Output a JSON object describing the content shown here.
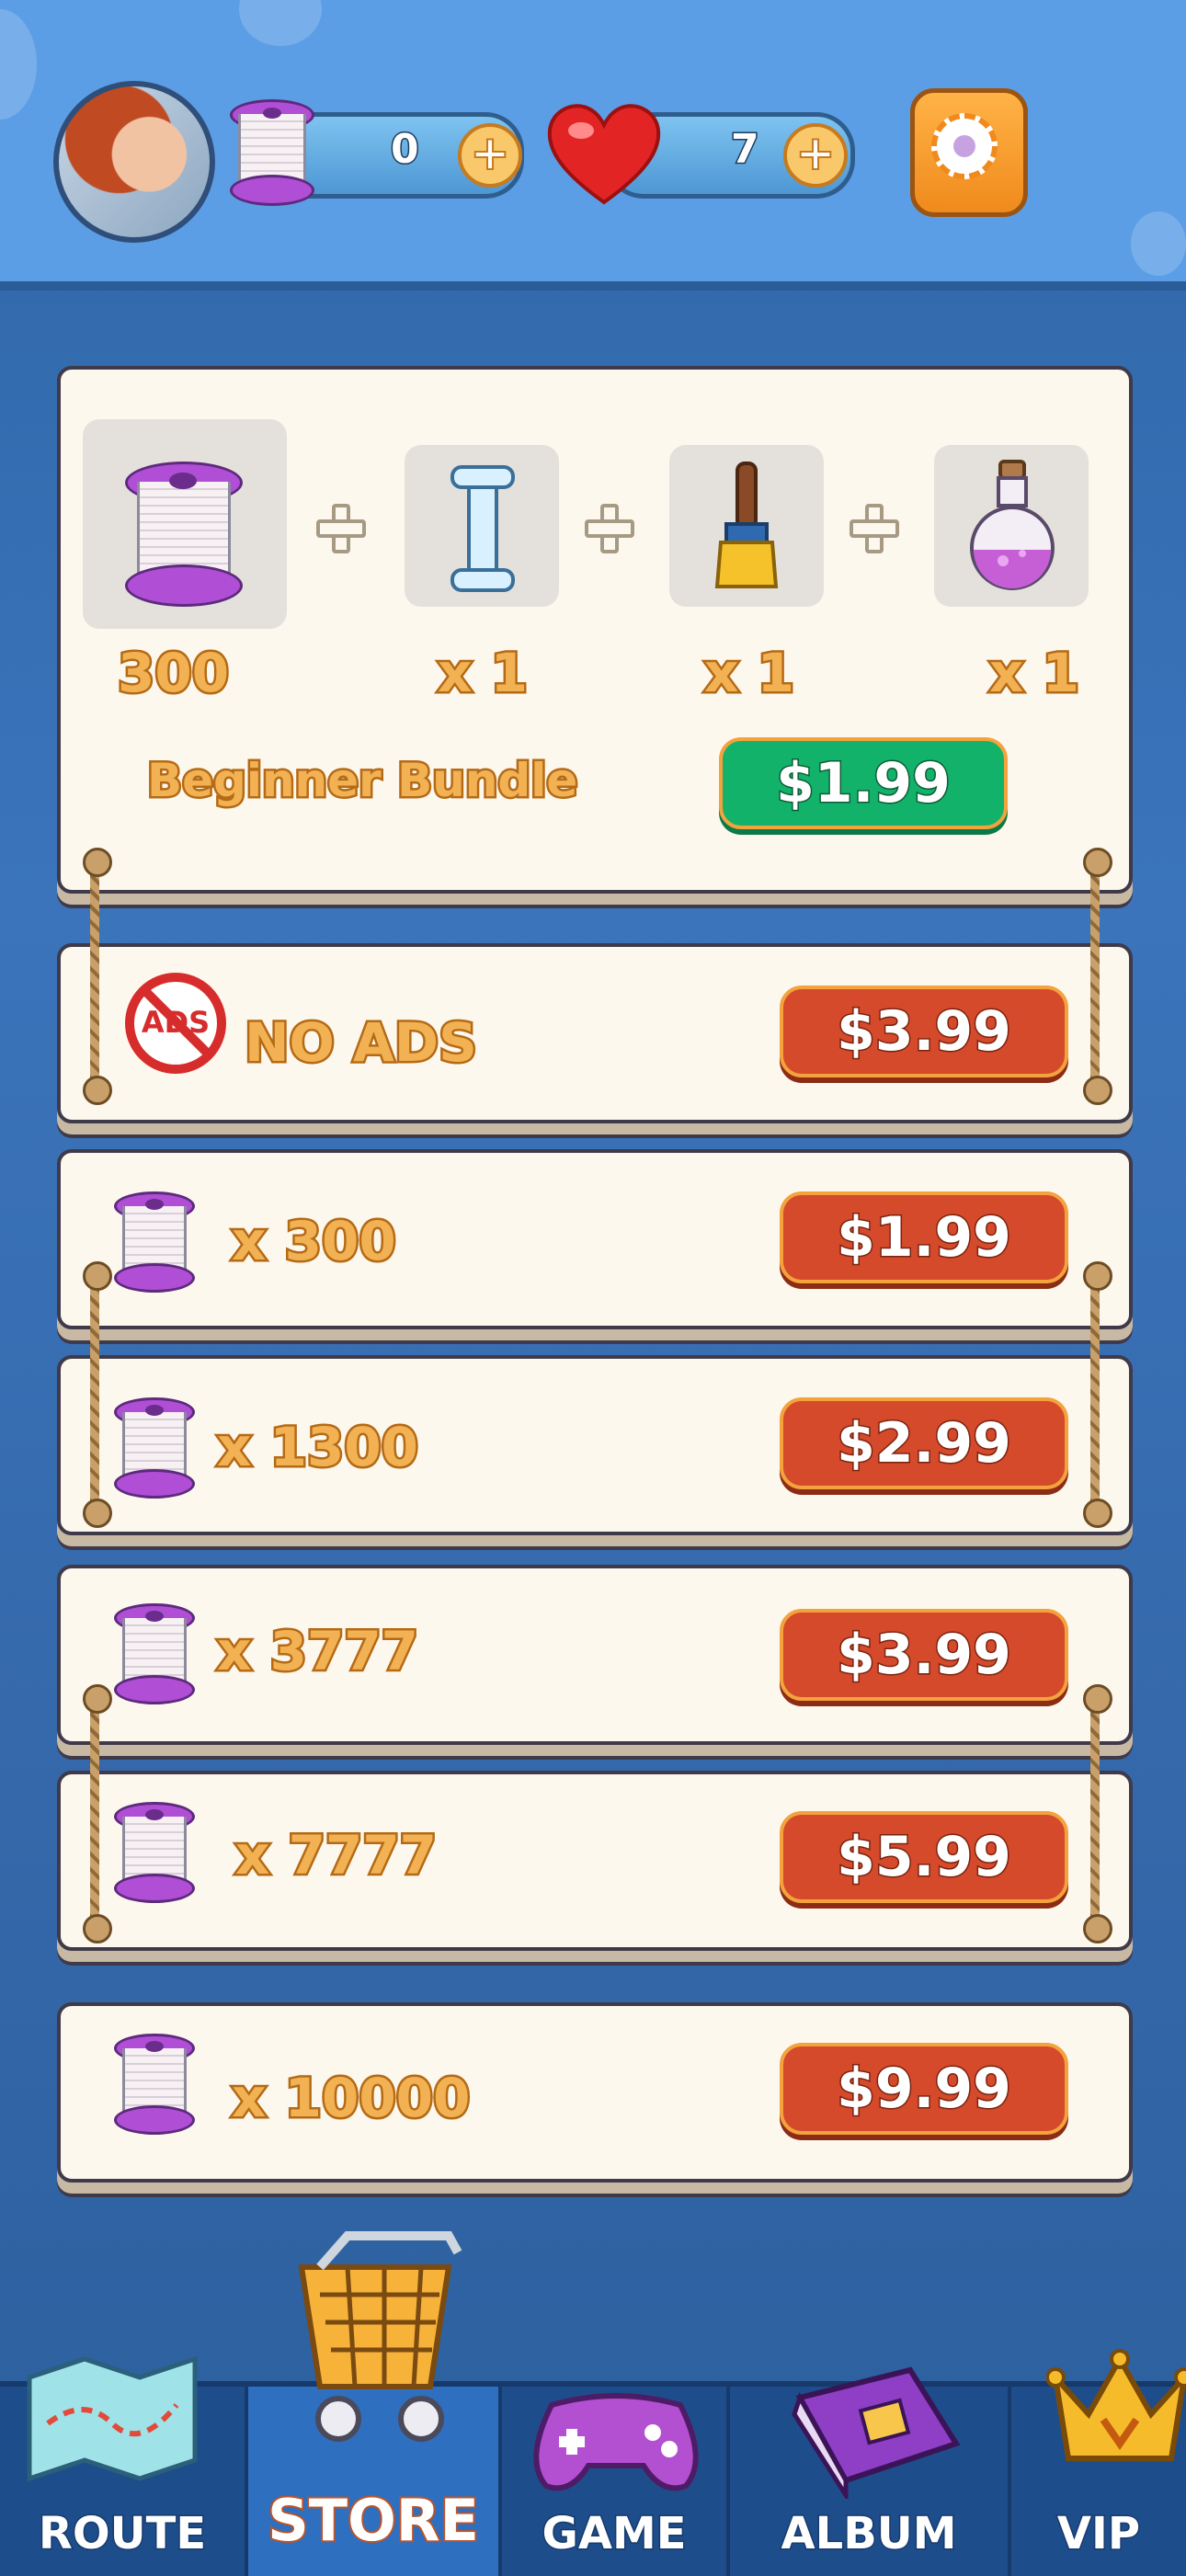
{
  "header": {
    "thread_count": "0",
    "hearts_count": "7"
  },
  "bundle": {
    "title": "Beginner Bundle",
    "price": "$1.99",
    "items": [
      {
        "icon": "thread-spool-icon",
        "qty": "300"
      },
      {
        "icon": "bone-icon",
        "qty": "x 1"
      },
      {
        "icon": "paintbrush-icon",
        "qty": "x 1"
      },
      {
        "icon": "potion-icon",
        "qty": "x 1"
      }
    ]
  },
  "no_ads": {
    "badge": "ADS",
    "label": "NO ADS",
    "price": "$3.99"
  },
  "offers": [
    {
      "qty": "x 300",
      "price": "$1.99"
    },
    {
      "qty": "x 1300",
      "price": "$2.99"
    },
    {
      "qty": "x 3777",
      "price": "$3.99"
    },
    {
      "qty": "x 7777",
      "price": "$5.99"
    },
    {
      "qty": "x 10000",
      "price": "$9.99"
    }
  ],
  "nav": {
    "route": "ROUTE",
    "store": "STORE",
    "game": "GAME",
    "album": "ALBUM",
    "vip": "VIP"
  },
  "colors": {
    "price_red": "#d44a2a",
    "price_green": "#13b26a",
    "text_orange": "#f2b253",
    "panel_cream": "#fdf8ee"
  }
}
